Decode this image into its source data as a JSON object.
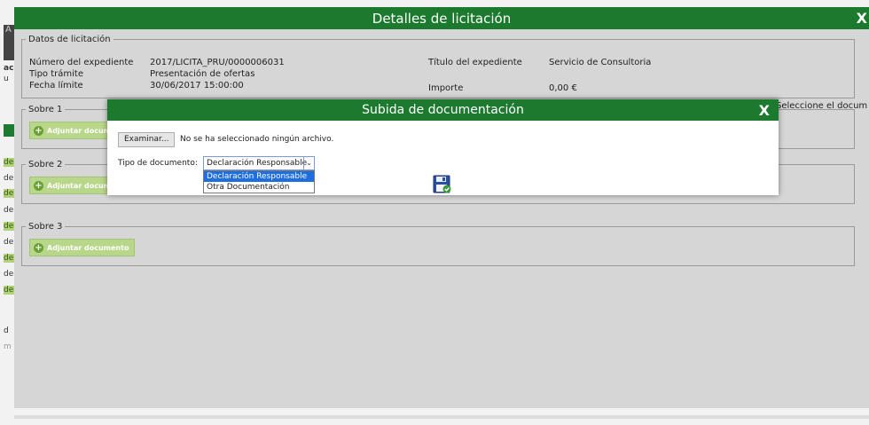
{
  "background": {
    "fragments": [
      "A",
      "ac",
      "u",
      "de",
      "de",
      "de",
      "de",
      "de",
      "de",
      "de",
      "de",
      "de",
      "d",
      "m"
    ]
  },
  "main_dialog": {
    "title": "Detalles de licitación",
    "close_label": "X",
    "datos": {
      "legend": "Datos de licitación",
      "numero_label": "Número del expediente",
      "numero_value": "2017/LICITA_PRU/0000006031",
      "tipo_label": "Tipo trámite",
      "tipo_value": "Presentación de ofertas",
      "fecha_label": "Fecha límite",
      "fecha_value": "30/06/2017 15:00:00",
      "titulo_label": "Título del expediente",
      "titulo_value": "Servicio de Consultoria",
      "importe_label": "Importe",
      "importe_value": "0,00 €"
    },
    "sobres": [
      {
        "legend": "Sobre 1",
        "button": "Adjuntar documento"
      },
      {
        "legend": "Sobre 2",
        "button": "Adjuntar documento"
      },
      {
        "legend": "Sobre 3",
        "button": "Adjuntar documento"
      }
    ],
    "seleccione_text": "Seleccione el docum"
  },
  "upload_dialog": {
    "title": "Subida de documentación",
    "close_label": "X",
    "browse_label": "Examinar...",
    "no_file_text": "No se ha seleccionado ningún archivo.",
    "tipo_label": "Tipo de documento:",
    "selected_value": "Declaración Responsable",
    "options": [
      "Declaración Responsable",
      "Otra Documentación"
    ],
    "save_icon": "save-disk-icon"
  }
}
